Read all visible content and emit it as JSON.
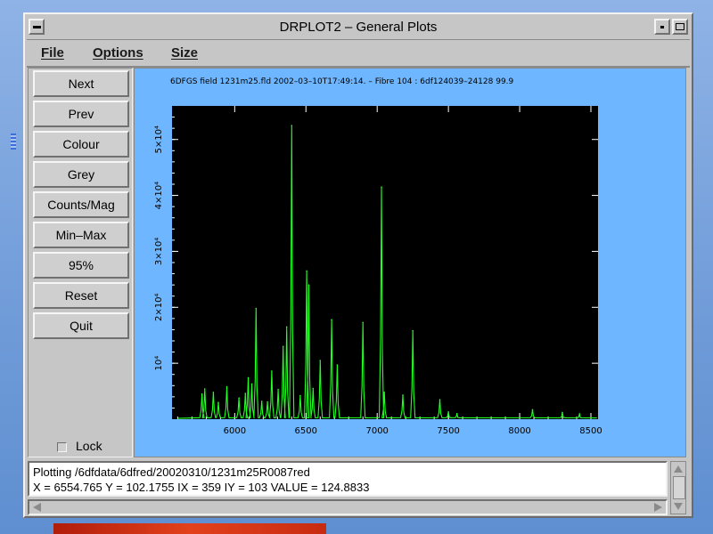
{
  "window": {
    "title": "DRPLOT2 – General Plots",
    "menu": [
      "File",
      "Options",
      "Size"
    ]
  },
  "sidebar": {
    "buttons": [
      "Next",
      "Prev",
      "Colour",
      "Grey",
      "Counts/Mag",
      "Min–Max",
      "95%",
      "Reset",
      "Quit"
    ],
    "lock_label": "Lock"
  },
  "plot": {
    "title": "6DFGS field  1231m25.fld  2002–03–10T17:49:14.  –  Fibre 104  :  6df124039–24128   99.9",
    "background_color": "#6eb6ff",
    "plot_bg_color": "#000000",
    "trace_color": "#22ff22"
  },
  "chart_data": {
    "type": "line",
    "title": "6DFGS field  1231m25.fld  2002–03–10T17:49:14.  –  Fibre 104  :  6df124039–24128   99.9",
    "xlabel": "",
    "ylabel": "",
    "xlim": [
      5560,
      8550
    ],
    "ylim": [
      0,
      56000
    ],
    "xticks": [
      6000,
      6500,
      7000,
      7500,
      8000,
      8500
    ],
    "yticks": [
      {
        "value": 10000,
        "label": "10⁴"
      },
      {
        "value": 20000,
        "label": "2×10⁴"
      },
      {
        "value": 30000,
        "label": "3×10⁴"
      },
      {
        "value": 40000,
        "label": "4×10⁴"
      },
      {
        "value": 50000,
        "label": "5×10⁴"
      }
    ],
    "baseline": 150,
    "peaks": [
      [
        5770,
        4500
      ],
      [
        5790,
        5400
      ],
      [
        5850,
        4800
      ],
      [
        5885,
        3000
      ],
      [
        5945,
        5800
      ],
      [
        6030,
        3800
      ],
      [
        6075,
        4600
      ],
      [
        6095,
        7400
      ],
      [
        6120,
        6300
      ],
      [
        6150,
        19800
      ],
      [
        6190,
        3200
      ],
      [
        6230,
        3100
      ],
      [
        6260,
        8600
      ],
      [
        6305,
        5300
      ],
      [
        6340,
        13000
      ],
      [
        6365,
        16500
      ],
      [
        6400,
        52500
      ],
      [
        6460,
        4200
      ],
      [
        6505,
        26500
      ],
      [
        6520,
        24000
      ],
      [
        6550,
        5500
      ],
      [
        6600,
        10500
      ],
      [
        6680,
        17800
      ],
      [
        6720,
        9700
      ],
      [
        6900,
        17300
      ],
      [
        7030,
        41500
      ],
      [
        7050,
        4800
      ],
      [
        7180,
        4300
      ],
      [
        7250,
        15800
      ],
      [
        7440,
        3500
      ],
      [
        7500,
        1300
      ],
      [
        7560,
        1000
      ],
      [
        8090,
        1700
      ],
      [
        8300,
        1200
      ],
      [
        8420,
        900
      ]
    ]
  },
  "status": {
    "line1": "Plotting /6dfdata/6dfred/20020310/1231m25R0087red",
    "line2": " X = 6554.765  Y = 102.1755  IX = 359  IY = 103  VALUE = 124.8833"
  }
}
